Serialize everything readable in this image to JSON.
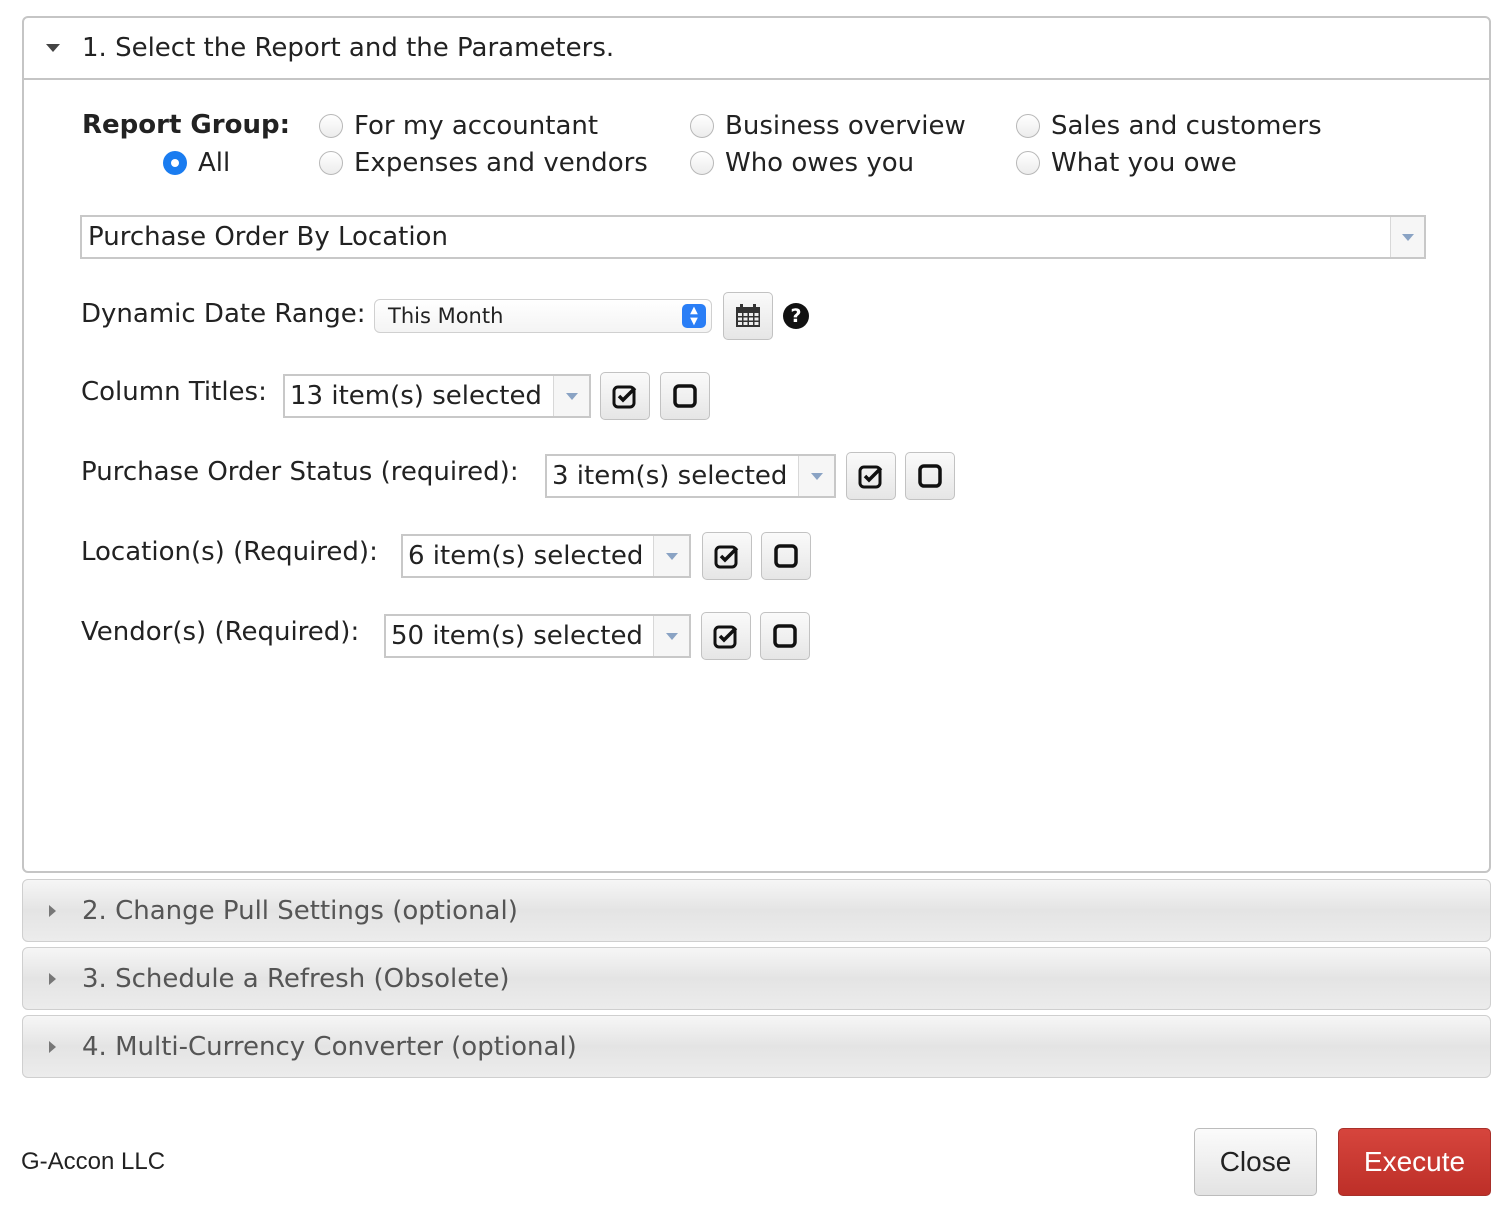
{
  "section1": {
    "title": "1. Select the Report and the Parameters."
  },
  "report_group": {
    "label": "Report Group:",
    "options": [
      "For my accountant",
      "Business overview",
      "Sales and customers",
      "All",
      "Expenses and vendors",
      "Who owes you",
      "What you owe"
    ],
    "selected": "All"
  },
  "report": {
    "value": "Purchase Order By Location"
  },
  "date_range": {
    "label": "Dynamic Date Range:",
    "value": "This Month",
    "help": "?"
  },
  "column_titles": {
    "label": "Column Titles:",
    "value": "13 item(s) selected"
  },
  "po_status": {
    "label": "Purchase Order Status (required):",
    "value": "3 item(s) selected"
  },
  "locations": {
    "label": "Location(s) (Required):",
    "value": "6 item(s) selected"
  },
  "vendors": {
    "label": "Vendor(s) (Required):",
    "value": "50 item(s) selected"
  },
  "section2": {
    "title": "2. Change Pull Settings (optional)"
  },
  "section3": {
    "title": "3. Schedule a Refresh (Obsolete)"
  },
  "section4": {
    "title": "4. Multi-Currency Converter (optional)"
  },
  "footer": {
    "company": "G-Accon LLC",
    "close_label": "Close",
    "execute_label": "Execute"
  },
  "colors": {
    "accent_blue": "#1a7cf0",
    "execute_red": "#c93a33"
  }
}
